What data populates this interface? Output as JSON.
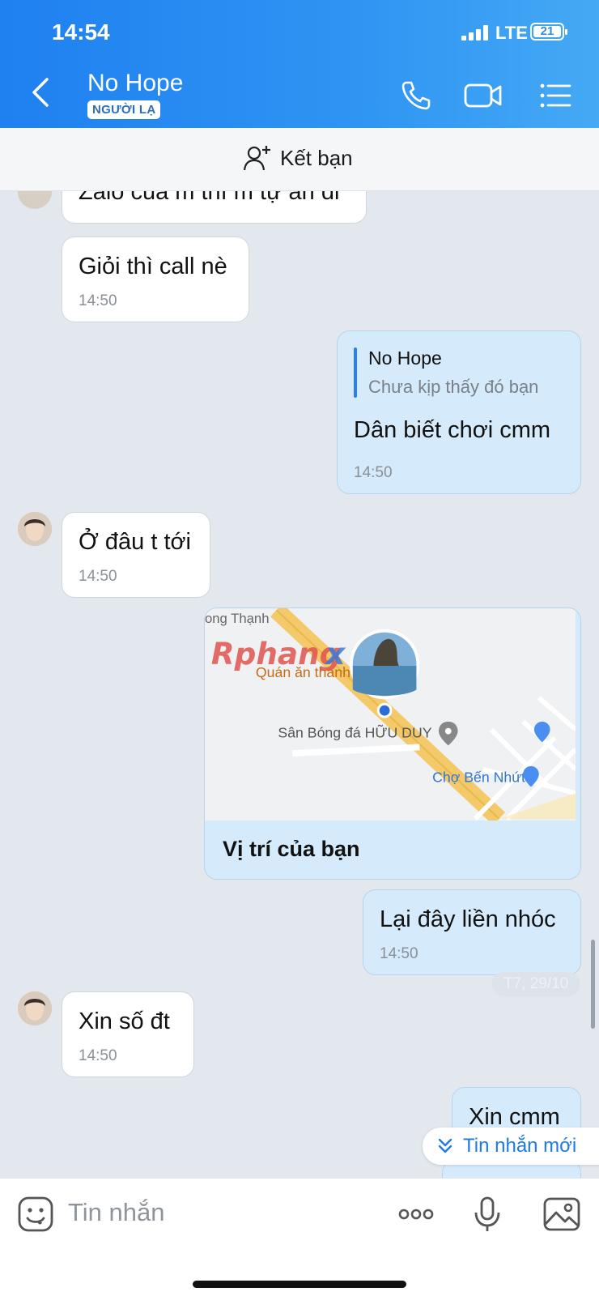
{
  "status_bar": {
    "time": "14:54",
    "network": "LTE",
    "battery": "21"
  },
  "header": {
    "title": "No Hope",
    "badge": "NGƯỜI LẠ",
    "icons": [
      "back-icon",
      "phone-icon",
      "video-call-icon",
      "menu-icon"
    ]
  },
  "friend_bar": {
    "label": "Kết bạn",
    "icon": "add-friend-icon"
  },
  "messages": [
    {
      "side": "in",
      "text": "Zalo của m thì m tự an đi"
    },
    {
      "side": "in",
      "text": "Giỏi thì call nè",
      "time": "14:50"
    },
    {
      "side": "out",
      "quote_name": "No Hope",
      "quote_text": "Chưa kịp thấy đó bạn",
      "text": "Dân biết chơi cmm",
      "time": "14:50"
    },
    {
      "side": "in",
      "text": "Ở đâu t tới",
      "time": "14:50"
    },
    {
      "side": "out",
      "type": "location",
      "map_labels": {
        "road": "ong Thạnh",
        "restaurant": "Quán ăn thanh",
        "field": "Sân Bóng đá HỮU DUY",
        "market": "Chợ Bến Nhứt"
      },
      "watermark": "Rphangx",
      "caption": "Vị trí của bạn"
    },
    {
      "side": "out",
      "text": "Lại đây liền nhóc",
      "time": "14:50"
    },
    {
      "side": "in",
      "text": "Xin số đt",
      "time": "14:50"
    },
    {
      "side": "out",
      "text": "Xin cmm"
    }
  ],
  "date_chip": "T7, 29/10",
  "new_messages_button": "Tin nhắn mới",
  "input": {
    "placeholder": "Tin nhắn",
    "icons": [
      "sticker-icon",
      "more-icon",
      "microphone-icon",
      "image-icon"
    ]
  },
  "colors": {
    "header_start": "#1f80f0",
    "header_end": "#45a9f4",
    "outgoing_bubble": "#d5ebfb",
    "incoming_bubble": "#ffffff",
    "chat_bg": "#e3e8ef",
    "accent": "#1e7be6"
  }
}
